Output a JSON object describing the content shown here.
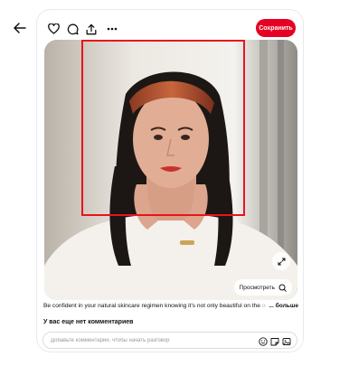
{
  "toolbar": {
    "save_label": "Сохранить",
    "icons": [
      "arrow-left-icon",
      "heart-icon",
      "comment-icon",
      "share-icon",
      "more-icon"
    ]
  },
  "pin": {
    "expand_icon": "expand-icon",
    "view_label": "Просмотреть",
    "description": "Be confident in your natural skincare regimen knowing it's not only beautiful on the",
    "description_faded": "outside",
    "more_label": "... больше"
  },
  "comments": {
    "empty_label": "У вас еще нет комментариев",
    "input_placeholder": "Добавьте комментарий, чтобы начать разговор",
    "icons": [
      "emoji-icon",
      "sticker-icon",
      "image-icon"
    ]
  },
  "colors": {
    "accent": "#e60023",
    "frame": "#e8141d"
  }
}
